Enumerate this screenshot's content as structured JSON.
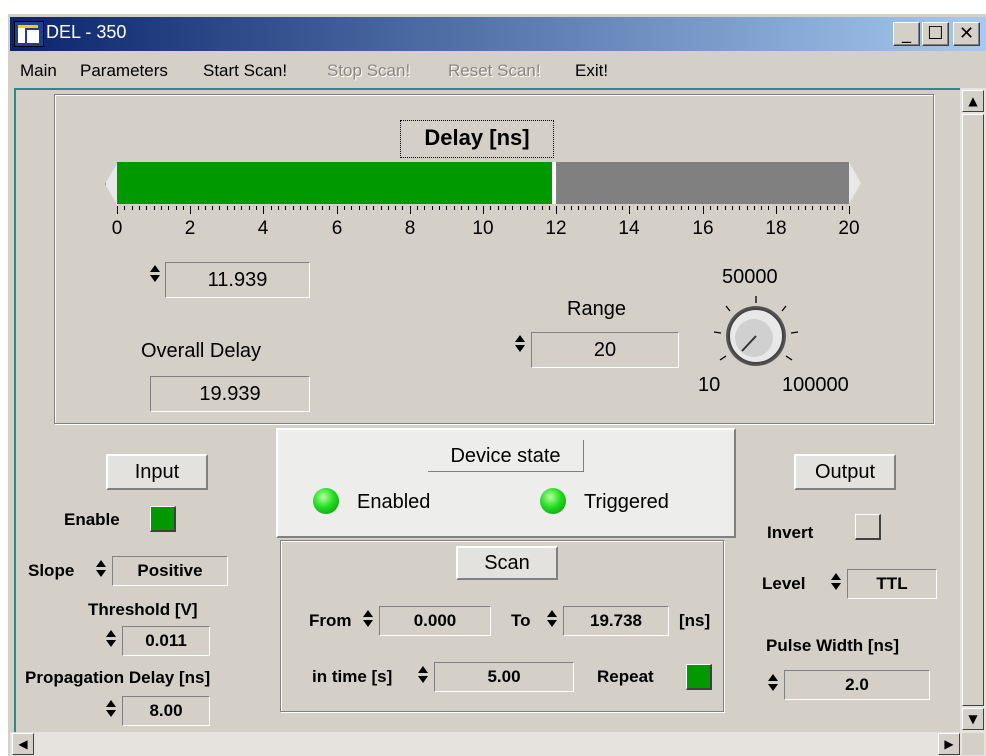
{
  "window": {
    "title": "DEL - 350",
    "min_glyph": "_",
    "max_glyph": "☐",
    "close_glyph": "✕"
  },
  "menu": [
    "Main",
    "Parameters",
    "Start Scan!",
    "Stop Scan!",
    "Reset Scan!",
    "Exit!"
  ],
  "menu_disabled": [
    "Stop Scan!",
    "Reset Scan!"
  ],
  "delay": {
    "title": "Delay [ns]",
    "slider_value": 11.939,
    "slider_min": 0,
    "slider_max": 20,
    "scale_labels": [
      "0",
      "2",
      "4",
      "6",
      "8",
      "10",
      "12",
      "14",
      "16",
      "18",
      "20"
    ],
    "value": "11.939",
    "overall_label": "Overall Delay",
    "overall_value": "19.939",
    "range_label": "Range",
    "range_value": "20",
    "knob_top": "50000",
    "knob_min": "10",
    "knob_max": "100000"
  },
  "device_state": {
    "title": "Device state",
    "enabled": "Enabled",
    "triggered": "Triggered"
  },
  "input": {
    "title": "Input",
    "enable_label": "Enable",
    "slope_label": "Slope",
    "slope_value": "Positive",
    "threshold_label": "Threshold [V]",
    "threshold_value": "0.011",
    "prop_label": "Propagation Delay [ns]",
    "prop_value": "8.00"
  },
  "scan": {
    "title": "Scan",
    "from_label": "From",
    "from_value": "0.000",
    "to_label": "To",
    "to_value": "19.738",
    "unit": "[ns]",
    "time_label": "in time [s]",
    "time_value": "5.00",
    "repeat_label": "Repeat"
  },
  "output": {
    "title": "Output",
    "invert_label": "Invert",
    "level_label": "Level",
    "level_value": "TTL",
    "pulse_label": "Pulse Width [ns]",
    "pulse_value": "2.0"
  },
  "colors": {
    "fill": "#009900",
    "track": "#808080",
    "led": "#22dd22",
    "checked": "#009900"
  }
}
